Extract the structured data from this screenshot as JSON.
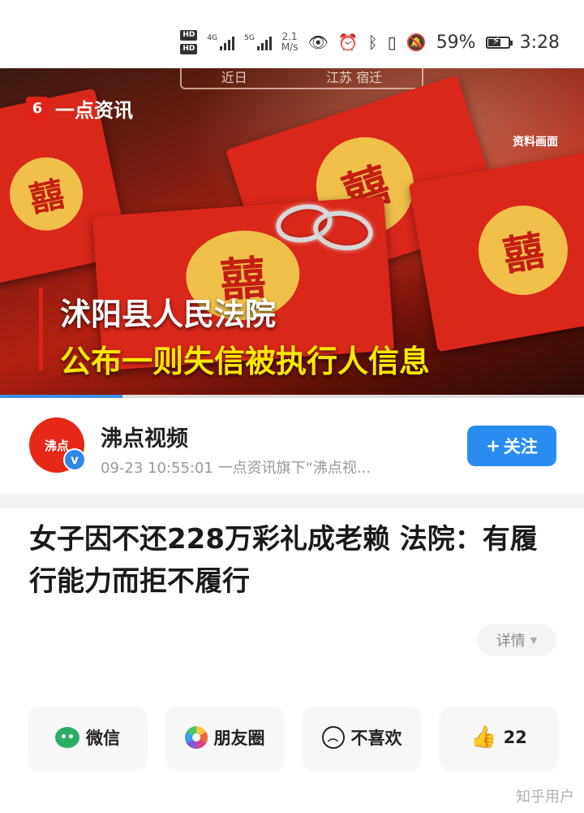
{
  "status_bar": {
    "hd1": "HD",
    "hd2": "HD",
    "net_type_1": "4G",
    "net_type_2": "5G",
    "speed_value": "2.1",
    "speed_unit": "M/s",
    "battery": "59%",
    "time": "3:28"
  },
  "video": {
    "brand": "一点资讯",
    "brand_logo": "6",
    "archive_tag": "资料画面",
    "top_tabs": [
      "近日",
      "江苏 宿迁"
    ],
    "caption_line1": "沭阳县人民法院",
    "caption_line2": "公布一则失信被执行人信息",
    "progress": 0.21
  },
  "author": {
    "avatar_text": "沸点",
    "name": "沸点视频",
    "meta": "09-23 10:55:01 一点资讯旗下“沸点视...",
    "follow_label": "关注",
    "follow_icon": "+"
  },
  "article": {
    "headline": "女子因不还228万彩礼成老赖 法院：有履行能力而拒不履行",
    "detail_label": "详情"
  },
  "actions": {
    "wechat": "微信",
    "moments": "朋友圈",
    "dislike": "不喜欢",
    "likes": "22"
  },
  "watermark": "知乎用户"
}
